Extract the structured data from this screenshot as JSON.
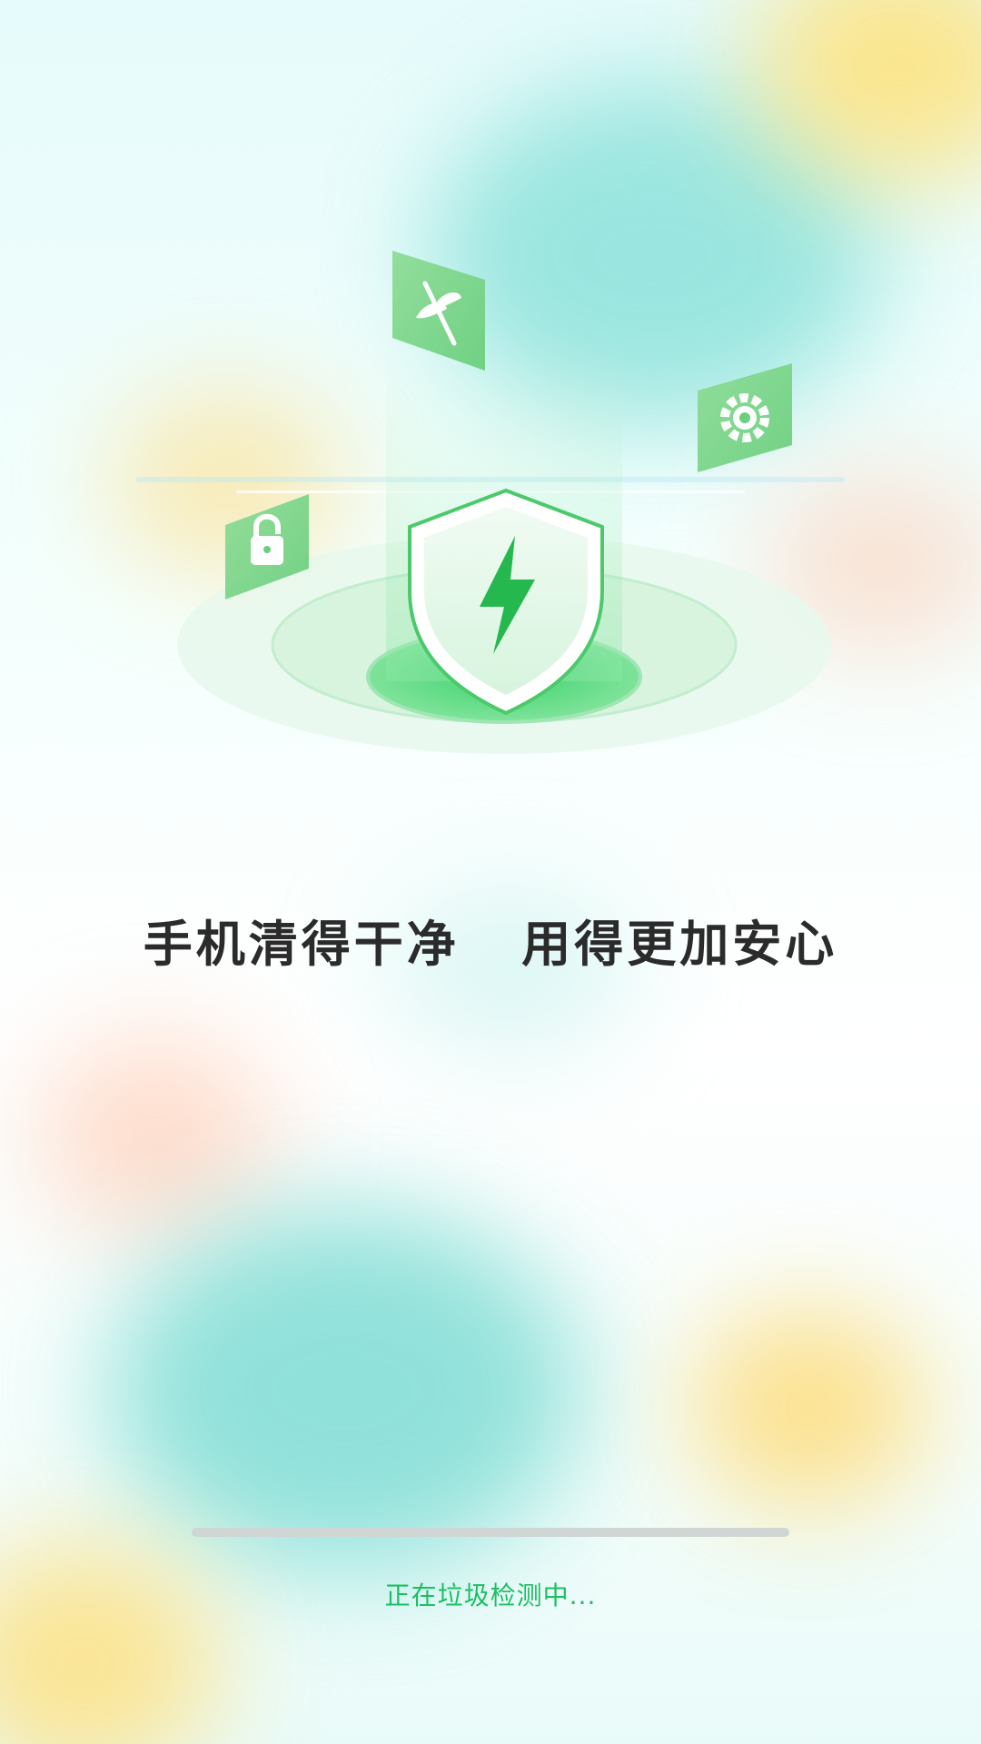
{
  "splash": {
    "slogan": "手机清得干净   用得更加安心",
    "status_text": "正在垃圾检测中...",
    "progress_fraction": 0.0,
    "accent_color": "#1cbf63",
    "icons": [
      "shield-bolt-icon",
      "lock-icon",
      "leaf-icon",
      "gear-icon"
    ]
  }
}
